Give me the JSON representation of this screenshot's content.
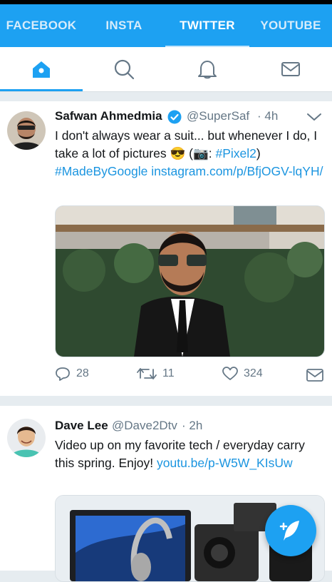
{
  "top_tabs": [
    "FACEBOOK",
    "INSTA",
    "TWITTER",
    "YOUTUBE"
  ],
  "nav_icons": [
    "home-icon",
    "search-icon",
    "notifications-icon",
    "messages-icon"
  ],
  "tweets": [
    {
      "name": "Safwan Ahmedmia",
      "verified": true,
      "handle": "@SuperSaf",
      "time": "· 4h",
      "text_line1": "I don't always wear a suit... but whenever I do, I take a lot of pictures 😎 (📷: ",
      "hashtag_pixel": "#Pixel2",
      "text_close": ")",
      "hashtag_madeby": "#MadeByGoogle",
      "link": "instagram.com/p/BfjOGV-lqYH/",
      "replies": "28",
      "retweets": "11",
      "likes": "324"
    },
    {
      "name": "Dave Lee",
      "handle": "@Dave2Dtv",
      "time": "· 2h",
      "text": "Video up on my favorite tech / everyday carry this spring. Enjoy!",
      "link": "youtu.be/p-W5W_KIsUw"
    }
  ],
  "colors": {
    "brand": "#1da1f2",
    "link": "#1b95e0",
    "muted": "#657786"
  }
}
